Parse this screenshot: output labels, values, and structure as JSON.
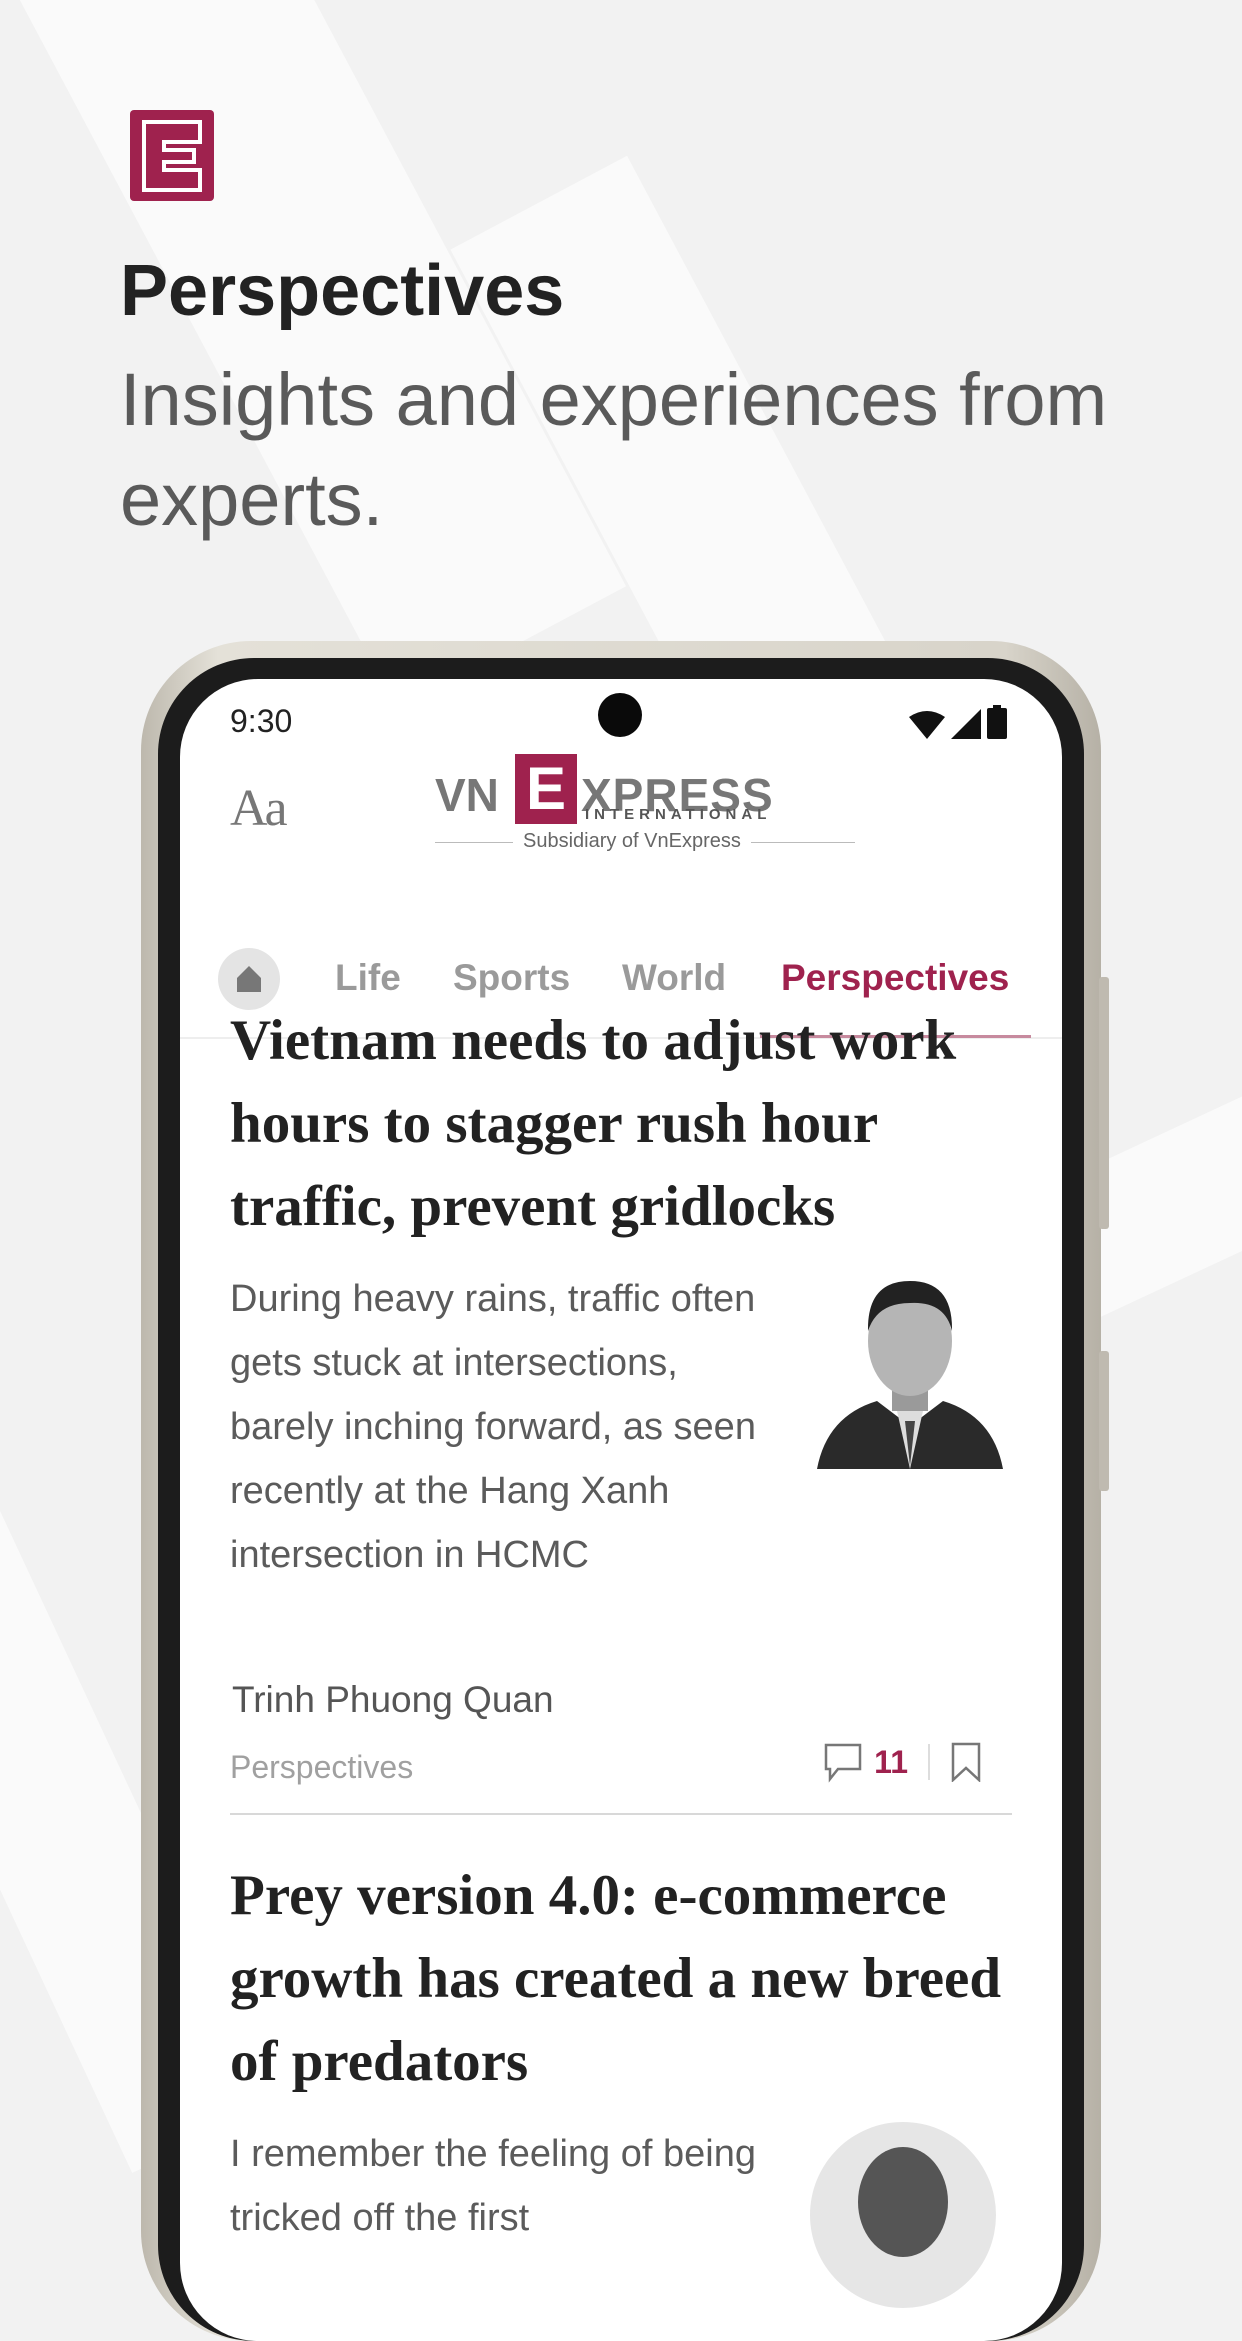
{
  "promo": {
    "title": "Perspectives",
    "subtitle": "Insights and experiences from experts.",
    "logo_letter": "E",
    "brand_color": "#9f224e"
  },
  "status_bar": {
    "time": "9:30",
    "icons": [
      "wifi-icon",
      "signal-icon",
      "battery-icon"
    ]
  },
  "header": {
    "font_size_button": "Aa",
    "brand_left": "VN",
    "brand_letter": "E",
    "brand_right": "XPRESS",
    "brand_sub": "INTERNATIONAL",
    "tagline": "Subsidiary of VnExpress"
  },
  "tabs": [
    {
      "label": "Life"
    },
    {
      "label": "Sports"
    },
    {
      "label": "World"
    },
    {
      "label": "Perspectives",
      "active": true
    }
  ],
  "articles": [
    {
      "title": "Vietnam needs to adjust work hours to stagger rush hour traffic, prevent gridlocks",
      "summary": "During heavy rains, traffic often gets stuck at intersections, barely inching forward, as seen recently at the Hang Xanh intersection in HCMC",
      "author": "Trinh Phuong Quan",
      "category": "Perspectives",
      "comments": "11"
    },
    {
      "title": "Prey version 4.0: e-commerce growth has created a new breed of predators",
      "summary": "I remember the feeling of being tricked off the first"
    }
  ]
}
